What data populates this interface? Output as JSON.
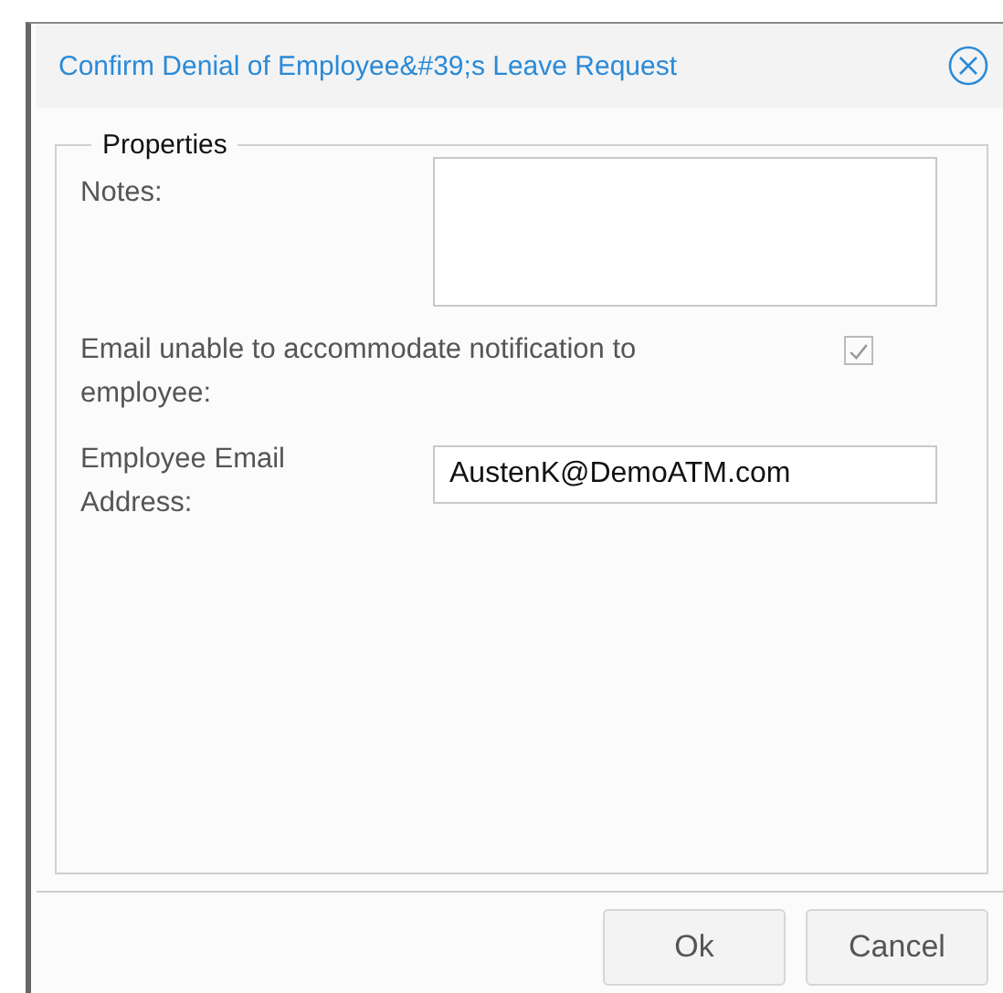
{
  "dialog": {
    "title": "Confirm Denial of Employee&#39;s Leave Request"
  },
  "properties": {
    "legend": "Properties",
    "fields": [
      {
        "kind": "textarea",
        "label": "Notes:"
      },
      {
        "kind": "checkbox",
        "label": "Email unable to accommodate notification to employee:",
        "checked": true
      },
      {
        "kind": "text",
        "label": "Employee Email Address:",
        "value": "AustenK@DemoATM.com"
      }
    ]
  },
  "buttons": [
    "Ok",
    "Cancel"
  ]
}
